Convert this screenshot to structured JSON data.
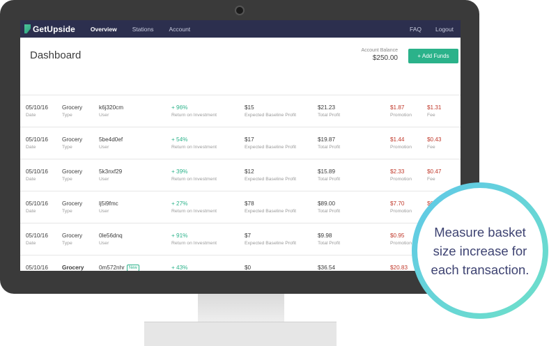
{
  "app": {
    "logo_text": "GetUpside",
    "nav": [
      "Overview",
      "Stations",
      "Account"
    ],
    "nav_right": [
      "FAQ",
      "Logout"
    ]
  },
  "dashboard": {
    "title": "Dashboard",
    "balance_label": "Account Balance",
    "balance_value": "$250.00",
    "add_funds_label": "+ Add Funds"
  },
  "labels": {
    "date": "Date",
    "type": "Type",
    "user": "User",
    "roi": "Return on Investment",
    "baseline": "Expected Baseline Profit",
    "total": "Total Profit",
    "promotion": "Promotion",
    "fee": "Fee",
    "new_badge": "New"
  },
  "rows": [
    {
      "date": "05/10/16",
      "type": "Grocery",
      "user": "k6j320cm",
      "roi": "+ 96%",
      "baseline": "$15",
      "total": "$21.23",
      "promotion": "$1.87",
      "fee": "$1.31"
    },
    {
      "date": "05/10/16",
      "type": "Grocery",
      "user": "5be4d0ef",
      "roi": "+ 54%",
      "baseline": "$17",
      "total": "$19.87",
      "promotion": "$1.44",
      "fee": "$0.43"
    },
    {
      "date": "05/10/16",
      "type": "Grocery",
      "user": "5k3nxf29",
      "roi": "+ 39%",
      "baseline": "$12",
      "total": "$15.89",
      "promotion": "$2.33",
      "fee": "$0.47"
    },
    {
      "date": "05/10/16",
      "type": "Grocery",
      "user": "lj5i9fmc",
      "roi": "+ 27%",
      "baseline": "$78",
      "total": "$89.00",
      "promotion": "$7.70",
      "fee": "$0.9"
    },
    {
      "date": "05/10/16",
      "type": "Grocery",
      "user": "0le56dnq",
      "roi": "+ 91%",
      "baseline": "$7",
      "total": "$9.98",
      "promotion": "$0.95",
      "fee": ""
    },
    {
      "date": "05/10/16",
      "type": "Grocery",
      "user": "0m572nhr",
      "roi": "+ 43%",
      "baseline": "$0",
      "total": "$36.54",
      "promotion": "$20.83",
      "fee": ""
    }
  ],
  "callout": {
    "text": "Measure basket size increase for each transaction."
  }
}
